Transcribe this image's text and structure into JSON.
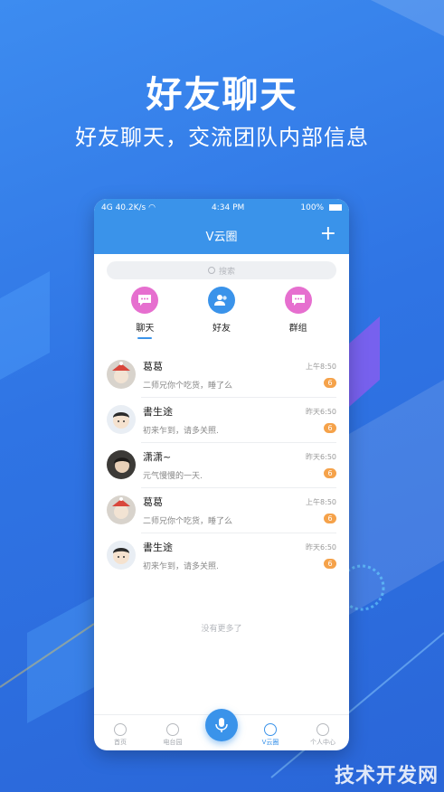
{
  "promo": {
    "headline": "好友聊天",
    "subline": "好友聊天，交流团队内部信息"
  },
  "status_bar": {
    "signal": "4G",
    "speed": "40.2K/s",
    "time": "4:34 PM",
    "battery": "100%"
  },
  "header": {
    "title": "V云圈",
    "add_label": "+"
  },
  "search": {
    "placeholder": "搜索"
  },
  "tabs": [
    {
      "label": "聊天",
      "icon": "chat-bubble-icon",
      "color": "#e66fcf",
      "active": true
    },
    {
      "label": "好友",
      "icon": "friends-icon",
      "color": "#3a93ea",
      "active": false
    },
    {
      "label": "群组",
      "icon": "group-chat-icon",
      "color": "#e66fcf",
      "active": false
    }
  ],
  "conversations": [
    {
      "name": "葛葛",
      "message": "二师兄你个吃货，睡了么",
      "time": "上午8:50",
      "unread": "6"
    },
    {
      "name": "書生途",
      "message": "初来乍到，请多关照.",
      "time": "昨天6:50",
      "unread": "6"
    },
    {
      "name": "潇潇~",
      "message": "元气慢慢的一天.",
      "time": "昨天6:50",
      "unread": "6"
    },
    {
      "name": "葛葛",
      "message": "二师兄你个吃货，睡了么",
      "time": "上午8:50",
      "unread": "6"
    },
    {
      "name": "書生途",
      "message": "初来乍到，请多关照.",
      "time": "昨天6:50",
      "unread": "6"
    }
  ],
  "no_more": "没有更多了",
  "bottom_nav": [
    {
      "label": "首页",
      "icon": "home-icon",
      "active": false
    },
    {
      "label": "电台园",
      "icon": "radio-icon",
      "active": false
    },
    {
      "label": "V云圈",
      "icon": "vcircle-icon",
      "active": true
    },
    {
      "label": "个人中心",
      "icon": "profile-icon",
      "active": false
    }
  ],
  "watermark": "技术开发网",
  "colors": {
    "accent": "#3a93ea",
    "badge": "#f5a24a",
    "background": "#2f74e4"
  }
}
